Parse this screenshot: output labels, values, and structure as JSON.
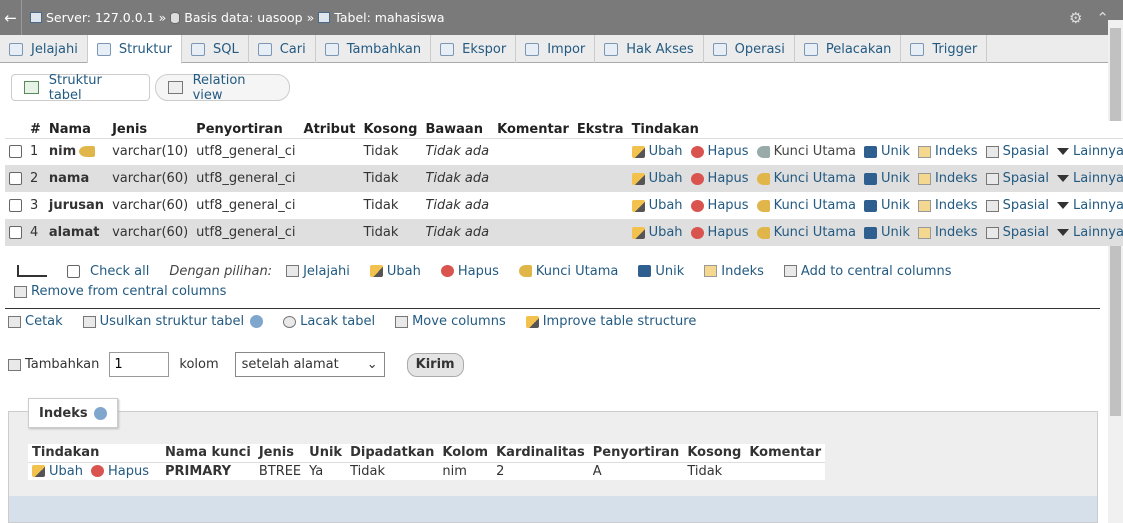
{
  "breadcrumb": {
    "server": "Server: 127.0.0.1",
    "database": "Basis data: uasoop",
    "table": "Tabel: mahasiswa",
    "sep": "»"
  },
  "tabs": [
    {
      "label": "Jelajahi",
      "icon": "browse-icon"
    },
    {
      "label": "Struktur",
      "icon": "structure-icon",
      "active": true
    },
    {
      "label": "SQL",
      "icon": "sql-icon"
    },
    {
      "label": "Cari",
      "icon": "search-icon"
    },
    {
      "label": "Tambahkan",
      "icon": "insert-icon"
    },
    {
      "label": "Ekspor",
      "icon": "export-icon"
    },
    {
      "label": "Impor",
      "icon": "import-icon"
    },
    {
      "label": "Hak Akses",
      "icon": "privileges-icon"
    },
    {
      "label": "Operasi",
      "icon": "operations-icon"
    },
    {
      "label": "Pelacakan",
      "icon": "tracking-icon"
    },
    {
      "label": "Trigger",
      "icon": "trigger-icon"
    }
  ],
  "subnav": {
    "structure_label": "Struktur tabel",
    "relation_label": "Relation view"
  },
  "structure": {
    "headers": [
      "#",
      "Nama",
      "Jenis",
      "Penyortiran",
      "Atribut",
      "Kosong",
      "Bawaan",
      "Komentar",
      "Ekstra",
      "Tindakan"
    ],
    "rows": [
      {
        "num": "1",
        "name": "nim",
        "type": "varchar(10)",
        "collation": "utf8_general_ci",
        "attr": "",
        "null": "Tidak",
        "default": "Tidak ada",
        "comment": "",
        "extra": "",
        "primary": true
      },
      {
        "num": "2",
        "name": "nama",
        "type": "varchar(60)",
        "collation": "utf8_general_ci",
        "attr": "",
        "null": "Tidak",
        "default": "Tidak ada",
        "comment": "",
        "extra": "",
        "primary": false
      },
      {
        "num": "3",
        "name": "jurusan",
        "type": "varchar(60)",
        "collation": "utf8_general_ci",
        "attr": "",
        "null": "Tidak",
        "default": "Tidak ada",
        "comment": "",
        "extra": "",
        "primary": false
      },
      {
        "num": "4",
        "name": "alamat",
        "type": "varchar(60)",
        "collation": "utf8_general_ci",
        "attr": "",
        "null": "Tidak",
        "default": "Tidak ada",
        "comment": "",
        "extra": "",
        "primary": false
      }
    ],
    "actions": {
      "edit": "Ubah",
      "drop": "Hapus",
      "primary": "Kunci Utama",
      "unique": "Unik",
      "index": "Indeks",
      "spatial": "Spasial",
      "more": "Lainnya"
    }
  },
  "with_selected": {
    "check_all": "Check all",
    "label": "Dengan pilihan:",
    "browse": "Jelajahi",
    "edit": "Ubah",
    "drop": "Hapus",
    "primary": "Kunci Utama",
    "unique": "Unik",
    "index": "Indeks",
    "add_central": "Add to central columns",
    "remove_central": "Remove from central columns"
  },
  "tools": {
    "print": "Cetak",
    "propose": "Usulkan struktur tabel",
    "track": "Lacak tabel",
    "move": "Move columns",
    "improve": "Improve table structure"
  },
  "add_columns": {
    "label": "Tambahkan",
    "count": "1",
    "unit": "kolom",
    "position": "setelah alamat",
    "submit": "Kirim"
  },
  "indexes": {
    "title": "Indeks",
    "headers": [
      "Tindakan",
      "Nama kunci",
      "Jenis",
      "Unik",
      "Dipadatkan",
      "Kolom",
      "Kardinalitas",
      "Penyortiran",
      "Kosong",
      "Komentar"
    ],
    "rows": [
      {
        "edit": "Ubah",
        "drop": "Hapus",
        "keyname": "PRIMARY",
        "type": "BTREE",
        "unique": "Ya",
        "packed": "Tidak",
        "column": "nim",
        "cardinality": "2",
        "collation": "A",
        "null": "Tidak",
        "comment": ""
      }
    ]
  },
  "colors": {
    "topbar": "#7a7a7a",
    "link": "#235a81",
    "row_even": "#dfdfdf"
  }
}
